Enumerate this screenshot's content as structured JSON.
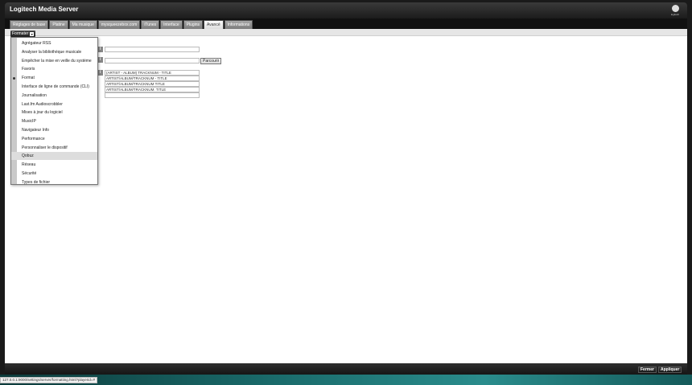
{
  "app": {
    "title": "Logitech Media Server",
    "logo_text": "logitech"
  },
  "tabs": [
    {
      "label": "Réglages de base"
    },
    {
      "label": "Platine"
    },
    {
      "label": "Ma musique"
    },
    {
      "label": "mysqueezebox.com"
    },
    {
      "label": "iTunes"
    },
    {
      "label": "Interface"
    },
    {
      "label": "Plugins"
    },
    {
      "label": "Avancé"
    },
    {
      "label": "Informations"
    }
  ],
  "section_select": {
    "value": "Formater",
    "arrow": "▾"
  },
  "fields": [
    {
      "icon": "i",
      "value": ""
    },
    {
      "icon": "i",
      "value": "",
      "button": "Parcourir"
    },
    {
      "icon": "i",
      "formats": [
        "(ARTIST - ALBUM) TRACKNUM - TITLE",
        "ARTIST/ALBUM/TRACKNUM - TITLE",
        "ARTIST/ALBUM/TRACKNUM TITLE",
        "ARTIST/ALBUM/TRACKNUM. TITLE",
        ""
      ]
    }
  ],
  "menu": {
    "items": [
      "Agrégateur RSS",
      "Analyser la bibliothèque musicale",
      "Empêcher la mise en veille du système",
      "Favoris",
      "Format",
      "Interface de ligne de commande (CLI)",
      "Journalisation",
      "Last.fm Audioscrobbler",
      "Mises à jour du logiciel",
      "MusicIP",
      "Navigateur Info",
      "Performance",
      "Personnaliser le dispositif",
      "Qobuz",
      "Réseau",
      "Sécurité",
      "Types de fichier"
    ],
    "selected_index": 4,
    "hover_index": 13
  },
  "footer": {
    "close_label": "Fermer",
    "apply_label": "Appliquer"
  },
  "status_url": "127.0.0.1:9000/settings/server/formatting.html?playerid=#"
}
